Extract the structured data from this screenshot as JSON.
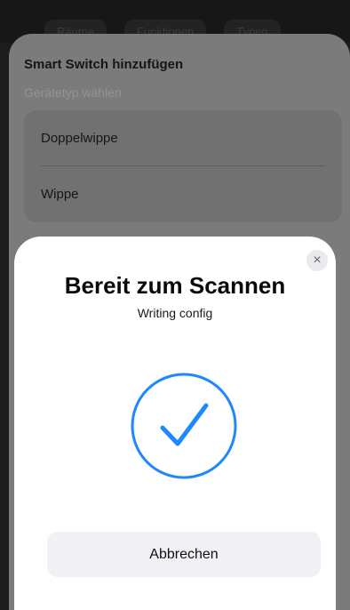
{
  "background_tabs": [
    "Räume",
    "Funktionen",
    "Typen"
  ],
  "sheet": {
    "title": "Smart Switch hinzufügen",
    "subtitle": "Gerätetyp wählen",
    "options": [
      "Doppelwippe",
      "Wippe"
    ]
  },
  "modal": {
    "close_icon": "×",
    "title": "Bereit zum Scannen",
    "status": "Writing config",
    "checkmark_icon": "checkmark-circle",
    "cancel_label": "Abbrechen",
    "accent_color": "#1e88ff"
  }
}
